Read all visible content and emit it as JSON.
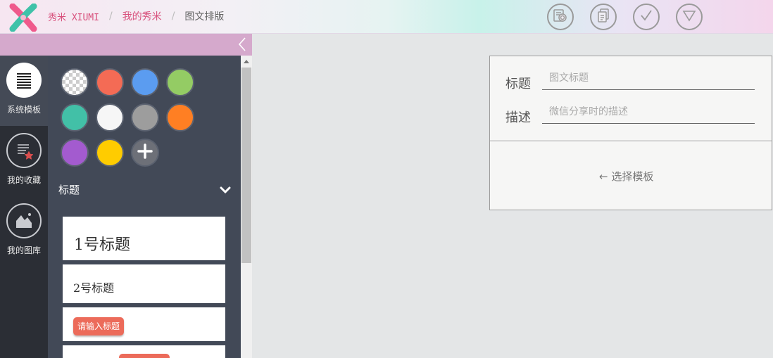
{
  "breadcrumb": {
    "brand": "秀米 XIUMI",
    "sep1": "/",
    "level2": "我的秀米",
    "sep2": "/",
    "current": "图文排版"
  },
  "toolbar": {
    "buttons": [
      {
        "icon": "preview-icon"
      },
      {
        "icon": "copy-icon"
      },
      {
        "icon": "check-icon"
      },
      {
        "icon": "dropdown-triangle-icon"
      }
    ],
    "icon_color": "#9a9a9a"
  },
  "rail": {
    "items": [
      {
        "label": "系统模板",
        "icon": "list-lines-icon",
        "active": true
      },
      {
        "label": "我的收藏",
        "icon": "favorite-doc-icon",
        "active": false
      },
      {
        "label": "我的图库",
        "icon": "image-mountain-icon",
        "active": false
      }
    ]
  },
  "colors": {
    "swatches": [
      "transparent",
      "#f46b55",
      "#5b9cf0",
      "#94cc64",
      "#42c0a7",
      "#f6f6f6",
      "#9d9d9d",
      "#ff7f23",
      "#a35bcf",
      "#ffcc00"
    ],
    "add_label": "+"
  },
  "section": {
    "title": "标题"
  },
  "templates": {
    "h1": "1号标题",
    "h2": "2号标题",
    "pill": "请输入标题"
  },
  "form": {
    "title_label": "标题",
    "title_placeholder": "图文标题",
    "desc_label": "描述",
    "desc_placeholder": "微信分享时的描述"
  },
  "main": {
    "choose_template": "← 选择模板"
  },
  "theme": {
    "brand_pink": "#d8507c",
    "panel_bg": "#424957",
    "rail_bg": "#2b2e35",
    "accent_red": "#ec6b5a"
  }
}
